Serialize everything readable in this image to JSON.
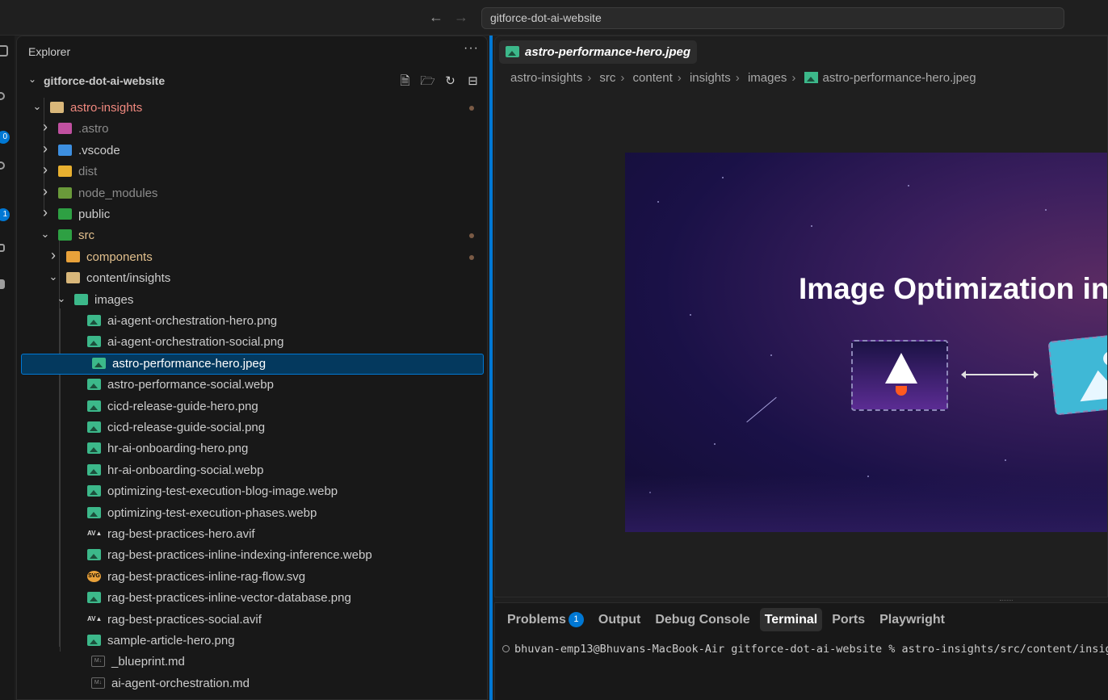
{
  "titlebar": {
    "search_text": "gitforce-dot-ai-website",
    "back_icon": "arrow-left-icon",
    "forward_icon": "arrow-right-icon"
  },
  "activity_bar": {
    "badges": [
      "0",
      "1"
    ]
  },
  "explorer": {
    "title": "Explorer",
    "more_icon": "ellipsis-icon",
    "root_folder": "gitforce-dot-ai-website",
    "root_actions": [
      "new-file-icon",
      "new-folder-icon",
      "refresh-icon",
      "collapse-all-icon"
    ],
    "items": [
      {
        "label": "astro-insights",
        "kind": "folder",
        "expanded": true,
        "color": "#f1897f",
        "modified": true
      },
      {
        "label": ".astro",
        "kind": "folder",
        "expanded": false,
        "color": "#8b8b8b",
        "icon_color": "#c050a0"
      },
      {
        "label": ".vscode",
        "kind": "folder",
        "expanded": false,
        "color": "#cccccc",
        "icon_color": "#3d8fe0"
      },
      {
        "label": "dist",
        "kind": "folder",
        "expanded": false,
        "color": "#8b8b8b",
        "icon_color": "#e8b030"
      },
      {
        "label": "node_modules",
        "kind": "folder",
        "expanded": false,
        "color": "#8b8b8b",
        "icon_color": "#6a9a3a"
      },
      {
        "label": "public",
        "kind": "folder",
        "expanded": false,
        "color": "#cccccc",
        "icon_color": "#2ea043"
      },
      {
        "label": "src",
        "kind": "folder",
        "expanded": true,
        "color": "#e2c08d",
        "icon_color": "#2ea043",
        "modified": true
      },
      {
        "label": "components",
        "kind": "folder",
        "expanded": false,
        "color": "#e2c08d",
        "icon_color": "#e8a13a",
        "modified": true
      },
      {
        "label": "content/insights",
        "kind": "folder",
        "expanded": true,
        "color": "#cccccc",
        "icon_color": "#d9b77a"
      },
      {
        "label": "images",
        "kind": "folder",
        "expanded": true,
        "color": "#cccccc",
        "icon_color": "#3cb88a"
      },
      {
        "label": "ai-agent-orchestration-hero.png",
        "kind": "image"
      },
      {
        "label": "ai-agent-orchestration-social.png",
        "kind": "image"
      },
      {
        "label": "astro-performance-hero.jpeg",
        "kind": "image",
        "selected": true
      },
      {
        "label": "astro-performance-social.webp",
        "kind": "image"
      },
      {
        "label": "cicd-release-guide-hero.png",
        "kind": "image"
      },
      {
        "label": "cicd-release-guide-social.png",
        "kind": "image"
      },
      {
        "label": "hr-ai-onboarding-hero.png",
        "kind": "image"
      },
      {
        "label": "hr-ai-onboarding-social.webp",
        "kind": "image"
      },
      {
        "label": "optimizing-test-execution-blog-image.webp",
        "kind": "image"
      },
      {
        "label": "optimizing-test-execution-phases.webp",
        "kind": "image"
      },
      {
        "label": "rag-best-practices-hero.avif",
        "kind": "avif"
      },
      {
        "label": "rag-best-practices-inline-indexing-inference.webp",
        "kind": "image"
      },
      {
        "label": "rag-best-practices-inline-rag-flow.svg",
        "kind": "svg"
      },
      {
        "label": "rag-best-practices-inline-vector-database.png",
        "kind": "image"
      },
      {
        "label": "rag-best-practices-social.avif",
        "kind": "avif"
      },
      {
        "label": "sample-article-hero.png",
        "kind": "image"
      },
      {
        "label": "_blueprint.md",
        "kind": "markdown"
      },
      {
        "label": "ai-agent-orchestration.md",
        "kind": "markdown"
      }
    ]
  },
  "editor": {
    "tab_label": "astro-performance-hero.jpeg",
    "breadcrumb": [
      "astro-insights",
      "src",
      "content",
      "insights",
      "images",
      "astro-performance-hero.jpeg"
    ],
    "preview_headline": "Image Optimization in"
  },
  "panel": {
    "tabs": [
      {
        "label": "Problems",
        "badge": "1"
      },
      {
        "label": "Output"
      },
      {
        "label": "Debug Console"
      },
      {
        "label": "Terminal",
        "active": true
      },
      {
        "label": "Ports"
      },
      {
        "label": "Playwright"
      }
    ],
    "terminal_line": "bhuvan-emp13@Bhuvans-MacBook-Air gitforce-dot-ai-website % astro-insights/src/content/insights"
  },
  "colors": {
    "accent": "#0078d4",
    "selection": "#04395e",
    "modified_dot": "#7a5a45"
  }
}
